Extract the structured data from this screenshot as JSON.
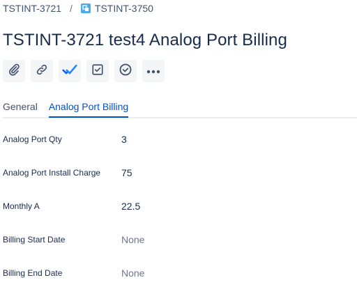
{
  "breadcrumb": {
    "parent": "TSTINT-3721",
    "separator": "/",
    "current": "TSTINT-3750",
    "current_icon": "subtask-icon"
  },
  "issue": {
    "title": "TSTINT-3721 test4 Analog Port Billing"
  },
  "toolbar": {
    "buttons": [
      {
        "icon": "paperclip-icon",
        "label": "Attach"
      },
      {
        "icon": "link-icon",
        "label": "Link issue"
      },
      {
        "icon": "double-check-icon",
        "label": "Approvals"
      },
      {
        "icon": "checkbox-icon",
        "label": "Checklist"
      },
      {
        "icon": "check-circle-icon",
        "label": "Done"
      },
      {
        "icon": "more-icon",
        "label": "More"
      }
    ]
  },
  "tabs": [
    {
      "label": "General",
      "active": false
    },
    {
      "label": "Analog Port Billing",
      "active": true
    }
  ],
  "fields": [
    {
      "label": "Analog Port Qty",
      "value": "3",
      "empty": false
    },
    {
      "label": "Analog Port Install Charge",
      "value": "75",
      "empty": false
    },
    {
      "label": "Monthly A",
      "value": "22.5",
      "empty": false
    },
    {
      "label": "Billing Start Date",
      "value": "None",
      "empty": true
    },
    {
      "label": "Billing End Date",
      "value": "None",
      "empty": true
    }
  ],
  "colors": {
    "accent": "#0052cc",
    "text": "#172b4d",
    "muted": "#6b778c",
    "button_bg": "#f4f5f7",
    "issue_icon": "#4bade8"
  }
}
